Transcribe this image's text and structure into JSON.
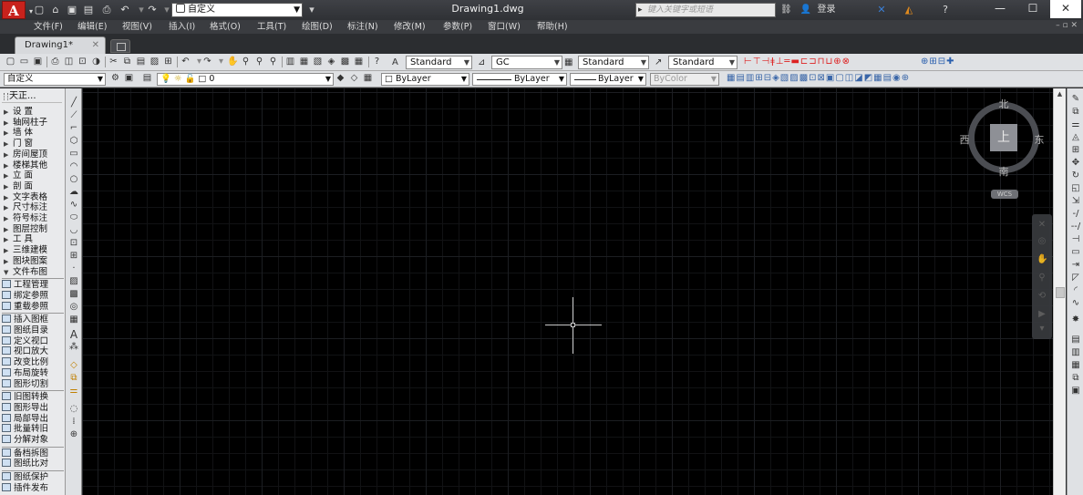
{
  "titlebar": {
    "logo": "A",
    "workspace": "自定义",
    "document_title": "Drawing1.dwg",
    "search_placeholder": "键入关键字或短语",
    "login": "登录"
  },
  "menu": [
    "文件(F)",
    "编辑(E)",
    "视图(V)",
    "插入(I)",
    "格式(O)",
    "工具(T)",
    "绘图(D)",
    "标注(N)",
    "修改(M)",
    "参数(P)",
    "窗口(W)",
    "帮助(H)"
  ],
  "tabs": [
    {
      "label": "Drawing1*"
    }
  ],
  "styles": {
    "text_style": "Standard",
    "dim_style": "GC",
    "table_style": "Standard",
    "mleader_style": "Standard"
  },
  "layer_bar": {
    "workspace_left": "自定义",
    "layer": "0",
    "color": "ByLayer",
    "linetype": "ByLayer",
    "lineweight": "ByLayer",
    "plot_style": "ByColor"
  },
  "left_panel": {
    "title": "天正...",
    "categories": [
      "设  置",
      "轴网柱子",
      "墙  体",
      "门  窗",
      "房间屋顶",
      "楼梯其他",
      "立  面",
      "剖  面",
      "文字表格",
      "尺寸标注",
      "符号标注",
      "图层控制",
      "工  具",
      "三维建模",
      "图块图案",
      "文件布图"
    ],
    "tools_group1": [
      "工程管理",
      "绑定参照",
      "重载参照"
    ],
    "tools_group2": [
      "插入图框",
      "图纸目录",
      "定义视口",
      "视口放大",
      "改变比例",
      "布局旋转",
      "图形切割"
    ],
    "tools_group3": [
      "旧图转换",
      "图形导出",
      "局部导出",
      "批量转旧",
      "分解对象"
    ],
    "tools_group4": [
      "备档拆图",
      "图纸比对"
    ],
    "tools_group5": [
      "图纸保护",
      "插件发布"
    ]
  },
  "viewcube": {
    "north": "北",
    "south": "南",
    "east": "东",
    "west": "西",
    "face": "上",
    "wcs": "WCS"
  },
  "icons": {
    "quick_access": [
      "new-icon",
      "open-icon",
      "save-icon",
      "saveas-icon",
      "print-icon",
      "undo-icon",
      "redo-icon"
    ],
    "draw_toolbar": [
      "line-icon",
      "polyline-icon",
      "arc-icon",
      "circle-icon",
      "rectangle-icon",
      "polygon-icon",
      "spline-icon",
      "ellipse-icon",
      "hatch-icon",
      "text-icon"
    ]
  }
}
